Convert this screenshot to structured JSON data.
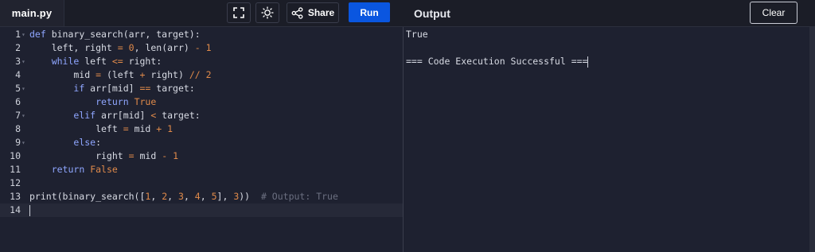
{
  "editor": {
    "filename": "main.py",
    "lines": [
      {
        "n": "1",
        "fold": true,
        "text": "def binary_search(arr, target):"
      },
      {
        "n": "2",
        "fold": false,
        "text": "    left, right = 0, len(arr) - 1"
      },
      {
        "n": "3",
        "fold": true,
        "text": "    while left <= right:"
      },
      {
        "n": "4",
        "fold": false,
        "text": "        mid = (left + right) // 2"
      },
      {
        "n": "5",
        "fold": true,
        "text": "        if arr[mid] == target:"
      },
      {
        "n": "6",
        "fold": false,
        "text": "            return True"
      },
      {
        "n": "7",
        "fold": true,
        "text": "        elif arr[mid] < target:"
      },
      {
        "n": "8",
        "fold": false,
        "text": "            left = mid + 1"
      },
      {
        "n": "9",
        "fold": true,
        "text": "        else:"
      },
      {
        "n": "10",
        "fold": false,
        "text": "            right = mid - 1"
      },
      {
        "n": "11",
        "fold": false,
        "text": "    return False"
      },
      {
        "n": "12",
        "fold": false,
        "text": ""
      },
      {
        "n": "13",
        "fold": false,
        "text": "print(binary_search([1, 2, 3, 4, 5], 3))  # Output: True"
      },
      {
        "n": "14",
        "fold": false,
        "text": ""
      }
    ],
    "active_line": 14
  },
  "toolbar": {
    "fullscreen_icon": "expand-icon",
    "theme_icon": "sun-icon",
    "share_icon": "share-icon",
    "share_label": "Share",
    "run_label": "Run"
  },
  "output": {
    "title": "Output",
    "clear_label": "Clear",
    "lines": [
      "True",
      "",
      "=== Code Execution Successful ==="
    ]
  },
  "colors": {
    "run_button": "#0a56e0",
    "background": "#1e2130",
    "keyword": "#8fa6ff",
    "number": "#e08a4a",
    "comment": "#6b6f80"
  }
}
